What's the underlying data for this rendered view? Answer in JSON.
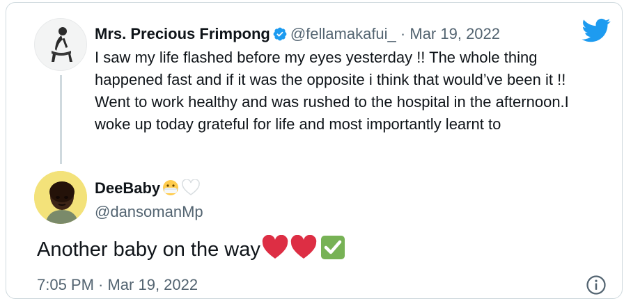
{
  "quoted_tweet": {
    "display_name": "Mrs. Precious Frimpong",
    "handle": "@fellamakafui_",
    "separator": "·",
    "date": "Mar 19, 2022",
    "text": "I saw my life flashed before my eyes yesterday !! The whole thing happened fast and if it was the opposite i think that would’ve been it !! Went to work healthy and was rushed to the hospital in the afternoon.I woke up today grateful for life and most importantly learnt to",
    "verified_icon": "verified-badge-icon"
  },
  "main_tweet": {
    "display_name": "DeeBaby",
    "name_emojis": [
      "face-in-mask-emoji",
      "white-heart-emoji"
    ],
    "handle": "@dansomanMp",
    "text": "Another baby on the way",
    "text_emojis": [
      "red-heart-emoji",
      "red-heart-emoji",
      "check-mark-button-emoji"
    ],
    "timestamp": "7:05 PM · Mar 19, 2022"
  },
  "icons": {
    "brand": "twitter-bird-icon",
    "info": "info-icon"
  },
  "colors": {
    "twitter_blue": "#1d9bf0",
    "secondary_text": "#536471",
    "border": "#cfd9de"
  }
}
